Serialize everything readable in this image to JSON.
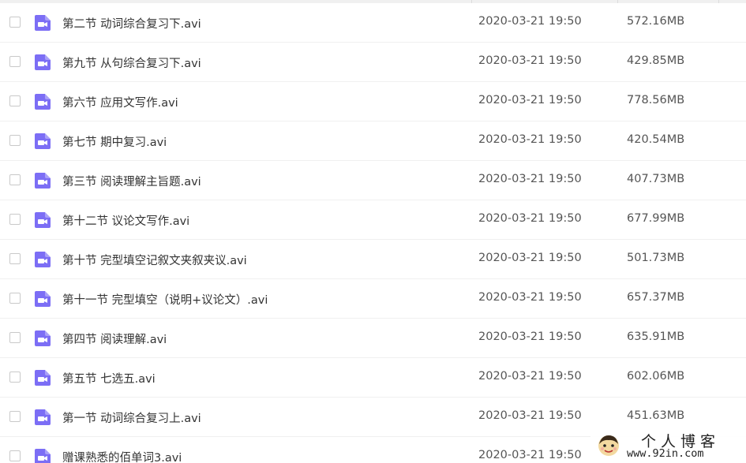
{
  "colors": {
    "video_icon": "#7c6ef5",
    "text_primary": "#333333",
    "text_secondary": "#555555"
  },
  "file_list": {
    "icon": "video-file-icon",
    "rows": [
      {
        "name": "第二节 动词综合复习下.avi",
        "modified": "2020-03-21 19:50",
        "size": "572.16MB"
      },
      {
        "name": "第九节 从句综合复习下.avi",
        "modified": "2020-03-21 19:50",
        "size": "429.85MB"
      },
      {
        "name": "第六节 应用文写作.avi",
        "modified": "2020-03-21 19:50",
        "size": "778.56MB"
      },
      {
        "name": "第七节 期中复习.avi",
        "modified": "2020-03-21 19:50",
        "size": "420.54MB"
      },
      {
        "name": "第三节 阅读理解主旨题.avi",
        "modified": "2020-03-21 19:50",
        "size": "407.73MB"
      },
      {
        "name": "第十二节 议论文写作.avi",
        "modified": "2020-03-21 19:50",
        "size": "677.99MB"
      },
      {
        "name": "第十节 完型填空记叙文夹叙夹议.avi",
        "modified": "2020-03-21 19:50",
        "size": "501.73MB"
      },
      {
        "name": "第十一节 完型填空（说明+议论文）.avi",
        "modified": "2020-03-21 19:50",
        "size": "657.37MB"
      },
      {
        "name": "第四节 阅读理解.avi",
        "modified": "2020-03-21 19:50",
        "size": "635.91MB"
      },
      {
        "name": "第五节 七选五.avi",
        "modified": "2020-03-21 19:50",
        "size": "602.06MB"
      },
      {
        "name": "第一节 动词综合复习上.avi",
        "modified": "2020-03-21 19:50",
        "size": "451.63MB"
      },
      {
        "name": "赠课熟悉的佰单词3.avi",
        "modified": "2020-03-21 19:50",
        "size": ""
      }
    ]
  },
  "watermark": {
    "title": "个人博客",
    "url": "www.92in.com"
  }
}
